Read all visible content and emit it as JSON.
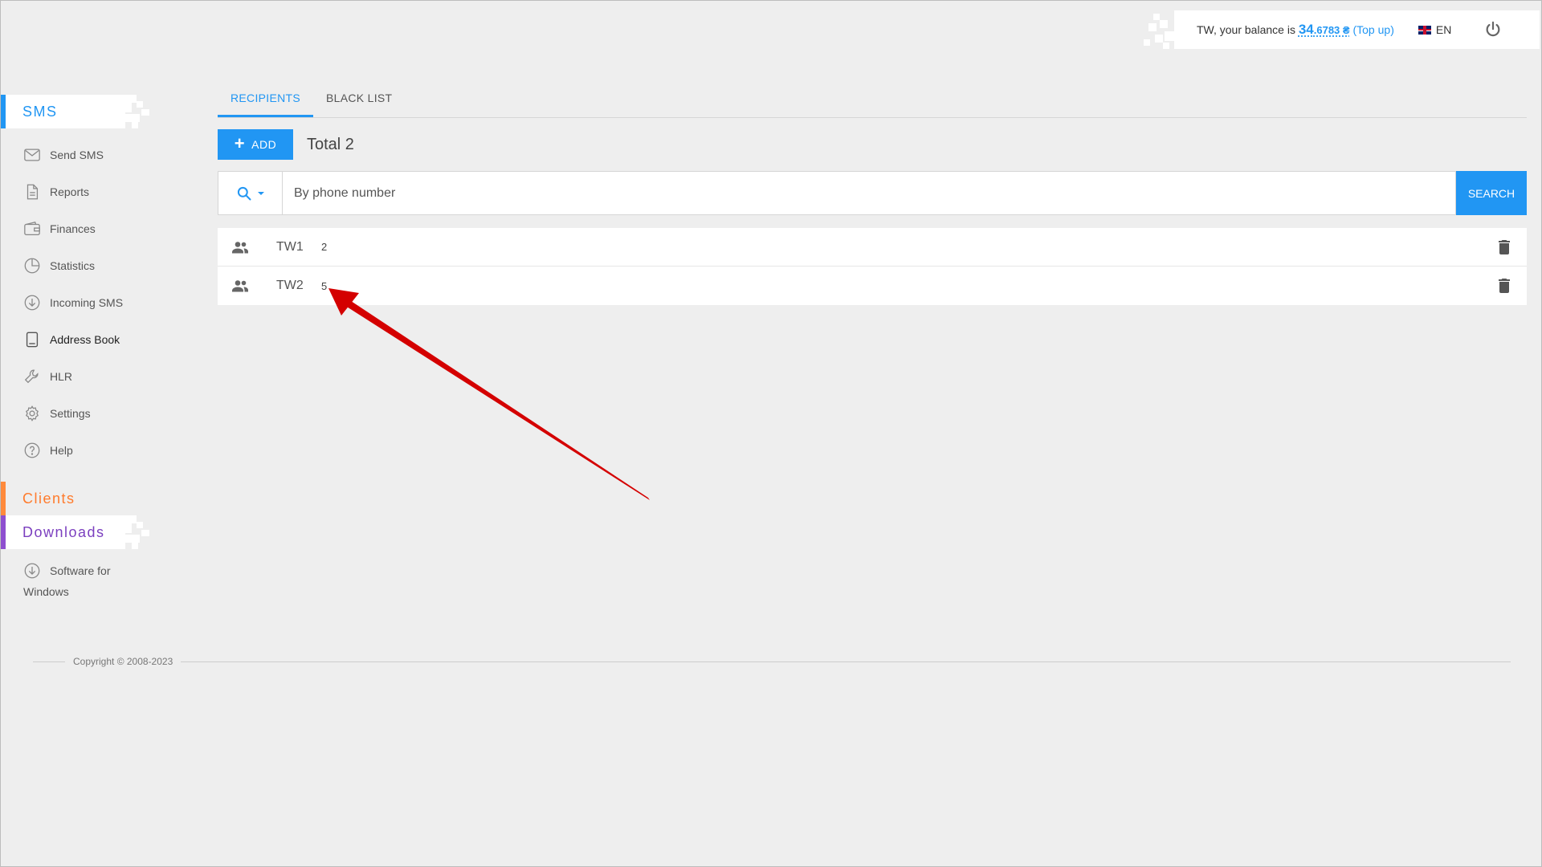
{
  "header": {
    "balance_prefix": "TW, your balance is ",
    "balance_int": "34",
    "balance_frac": ".6783 ₴",
    "topup_label": "Top up",
    "language": "EN"
  },
  "sidebar": {
    "sms_title": "SMS",
    "items": [
      {
        "label": "Send SMS",
        "icon": "mail-icon"
      },
      {
        "label": "Reports",
        "icon": "document-icon"
      },
      {
        "label": "Finances",
        "icon": "wallet-icon"
      },
      {
        "label": "Statistics",
        "icon": "pie-chart-icon"
      },
      {
        "label": "Incoming SMS",
        "icon": "download-circle-icon"
      },
      {
        "label": "Address Book",
        "icon": "book-icon"
      },
      {
        "label": "HLR",
        "icon": "wrench-icon"
      },
      {
        "label": "Settings",
        "icon": "gear-icon"
      },
      {
        "label": "Help",
        "icon": "help-icon"
      }
    ],
    "clients_title": "Clients",
    "downloads_title": "Downloads",
    "software_label_1": "Software for",
    "software_label_2": "Windows"
  },
  "main": {
    "tabs": [
      {
        "label": "RECIPIENTS",
        "active": true
      },
      {
        "label": "BLACK LIST",
        "active": false
      }
    ],
    "add_label": "ADD",
    "total_label": "Total 2",
    "search": {
      "placeholder": "By phone number",
      "button_label": "SEARCH"
    },
    "groups": [
      {
        "name": "TW1",
        "count": "2"
      },
      {
        "name": "TW2",
        "count": "5"
      }
    ]
  },
  "footer": {
    "copyright": "Copyright © 2008-2023"
  },
  "colors": {
    "accent": "#2196f3",
    "clients": "#ff7b2c",
    "downloads": "#7b3fbf",
    "annotation_arrow": "#d40000"
  }
}
